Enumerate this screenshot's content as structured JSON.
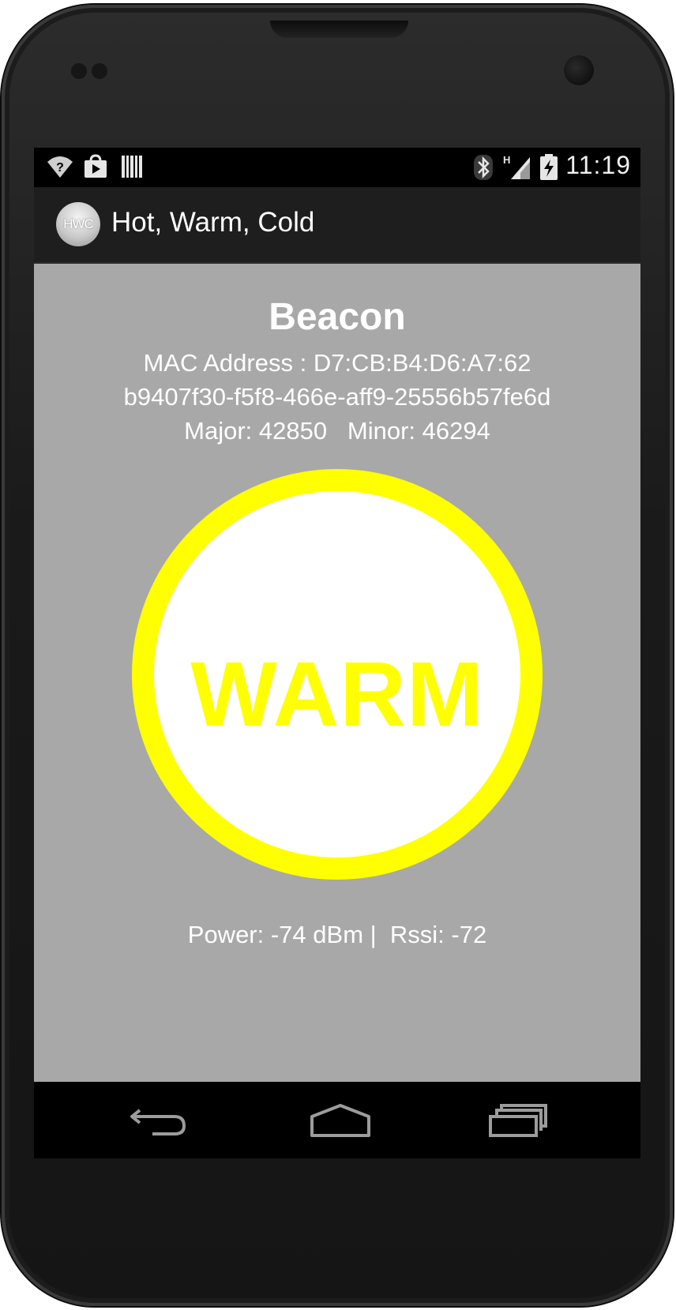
{
  "status_bar": {
    "time": "11:19",
    "icons_left": [
      "wifi-question-icon",
      "play-store-icon",
      "barcode-icon"
    ],
    "icons_right": [
      "bluetooth-icon",
      "signal-h-icon",
      "battery-charging-icon"
    ]
  },
  "action_bar": {
    "logo_text": "HWC",
    "title": "Hot, Warm, Cold"
  },
  "beacon": {
    "title": "Beacon",
    "mac_line": "MAC Address : D7:CB:B4:D6:A7:62",
    "uuid": "b9407f30-f5f8-466e-aff9-25556b57fe6d",
    "major_minor": "Major: 42850   Minor: 46294",
    "status": "WARM",
    "power_line": "Power: -74 dBm |  Rssi: -72"
  },
  "colors": {
    "content_background": "#a8a8a8",
    "status_color": "#ffff00",
    "circle_fill": "#ffffff",
    "action_bar": "#1e1e1e"
  },
  "nav_bar": {
    "buttons": [
      "back-icon",
      "home-icon",
      "recents-icon"
    ]
  }
}
